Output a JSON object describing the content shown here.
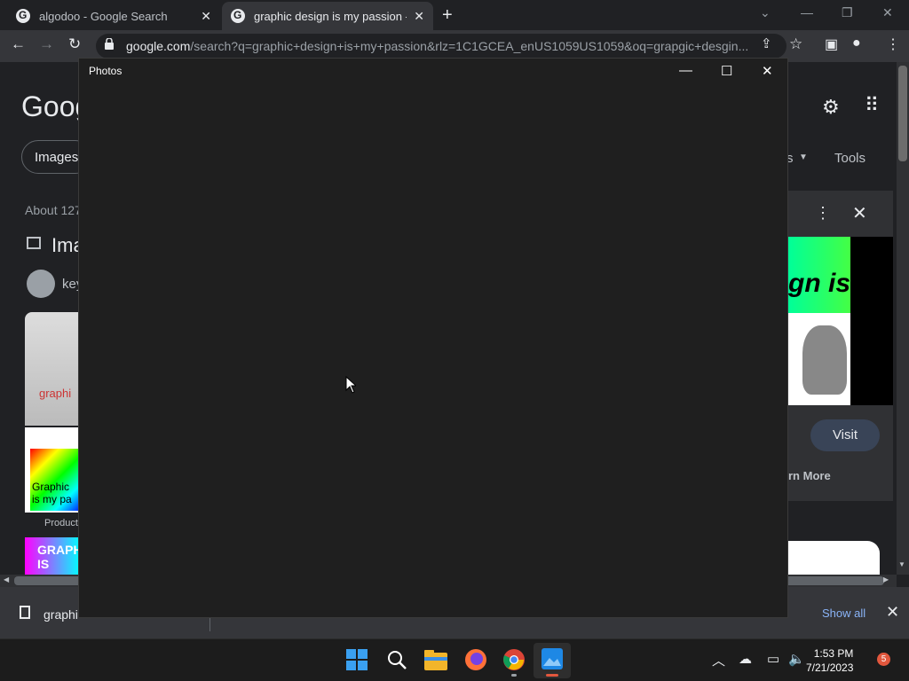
{
  "browser": {
    "tabs": [
      {
        "label": "algodoo - Google Search",
        "close": "✕"
      },
      {
        "label": "graphic design is my passion - G",
        "close": "✕"
      }
    ],
    "new_tab": "+",
    "url_domain": "google.com",
    "url_rest": "/search?q=graphic+design+is+my+passion&rlz=1C1GCEA_enUS1059US1059&oq=grapgic+desgin..."
  },
  "google": {
    "logo": "Goog",
    "images_chip": "Images",
    "about": "About 127",
    "images_heading": "Ima",
    "key_chip": "key",
    "thumb1_text": "graphi",
    "thumb2_text": "Graphic is my pa",
    "product_label": "Product",
    "thumb3_text": "GRAPH IS",
    "tools": "Tools",
    "partial_s": "s",
    "preview_text": "gn is",
    "visit": "Visit",
    "learn_more": "rn More"
  },
  "downloads": {
    "file_name": "graphi",
    "show_all": "Show all"
  },
  "photos": {
    "title": "Photos"
  },
  "taskbar": {
    "time": "1:53 PM",
    "date": "7/21/2023",
    "badge": "5"
  },
  "colors": {
    "photos_bg": "#1f1f1f",
    "chrome_dark": "#202124",
    "visit_button": "#394457",
    "notification_badge": "#e2573d"
  }
}
